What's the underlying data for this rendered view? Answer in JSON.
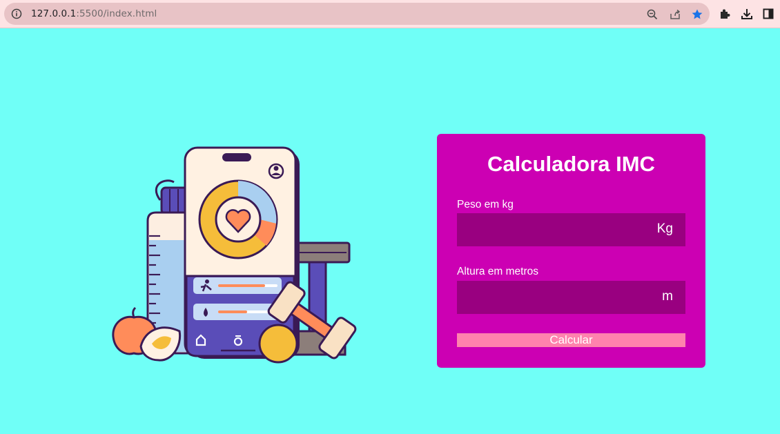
{
  "browser": {
    "url_host": "127.0.0.1",
    "url_rest": ":5500/index.html",
    "icons": [
      "info-icon",
      "zoom-icon",
      "share-icon",
      "bookmark-star-icon",
      "extensions-icon",
      "download-icon",
      "side-panel-icon"
    ]
  },
  "card": {
    "title": "Calculadora IMC",
    "weight_label": "Peso em kg",
    "weight_unit": "Kg",
    "height_label": "Altura em metros",
    "height_unit": "m",
    "button_label": "Calcular"
  },
  "colors": {
    "page_bg": "#70fff7",
    "card_bg": "#cc00b3",
    "input_bg": "#990080",
    "button_bg": "#ff82ad",
    "text": "#ffffff"
  }
}
